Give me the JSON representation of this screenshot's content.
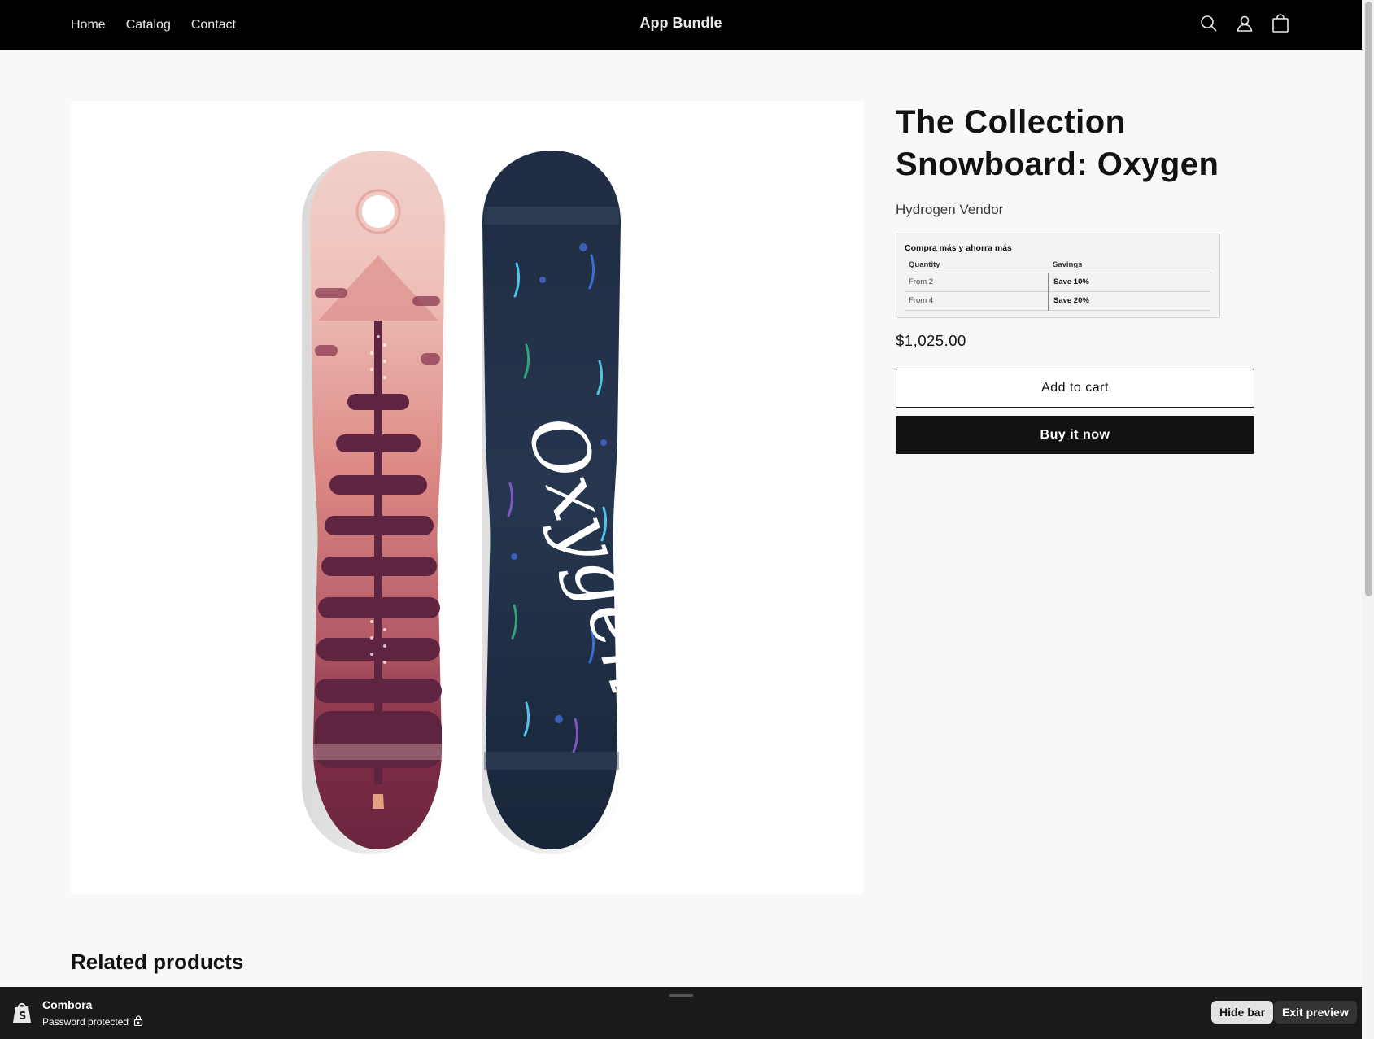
{
  "header": {
    "nav": [
      "Home",
      "Catalog",
      "Contact"
    ],
    "store_title": "App Bundle",
    "icons": [
      "search-icon",
      "account-icon",
      "cart-icon"
    ]
  },
  "product": {
    "image_alt": "The Collection Snowboard: Oxygen product image (two snowboards: pink forest design and navy 'Oxygen' lettering)",
    "title": "The Collection Snowboard: Oxygen",
    "vendor": "Hydrogen Vendor",
    "discount": {
      "title": "Compra más y ahorra más",
      "headers": [
        "Quantity",
        "Savings"
      ],
      "rows": [
        {
          "quantity": "From 2",
          "savings": "Save 10%"
        },
        {
          "quantity": "From 4",
          "savings": "Save 20%"
        }
      ]
    },
    "price": "$1,025.00",
    "add_to_cart_label": "Add to cart",
    "buy_now_label": "Buy it now"
  },
  "related": {
    "heading": "Related products"
  },
  "preview_bar": {
    "store_name": "Combora",
    "status": "Password protected",
    "hide_label": "Hide bar",
    "exit_label": "Exit preview"
  },
  "colors": {
    "header_bg": "#000000",
    "page_bg": "#f8f8f7",
    "button_dark": "#121212",
    "preview_bar_bg": "#1a1a1a"
  }
}
